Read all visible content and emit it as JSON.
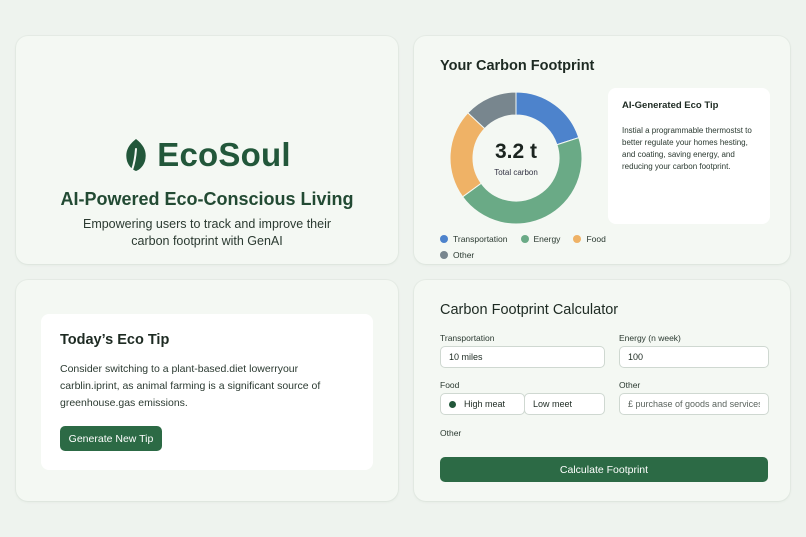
{
  "brand": {
    "name": "EcoSoul",
    "tagline": "AI-Powered Eco-Conscious Living",
    "description": "Empowering users to track and improve their carbon footprint with GenAI",
    "accent_color": "#22573a",
    "logo_icon": "leaf-icon"
  },
  "footprint": {
    "title": "Your Carbon Footprint",
    "total_value": "3.2 t",
    "total_label": "Total carbon",
    "ai_tip": {
      "title": "AI-Generated Eco Tip",
      "text": "Instial a programmable thermostst to better regulate your homes hesting, and coating, saving energy, and reducing your carbon footprint."
    }
  },
  "chart_data": {
    "type": "pie",
    "categories": [
      "Transportation",
      "Energy",
      "Food",
      "Other"
    ],
    "values": [
      20,
      45,
      22,
      13
    ],
    "colors": [
      "#4d83cc",
      "#6aaa86",
      "#efb266",
      "#78868e"
    ],
    "legend_position": "bottom-left",
    "center_text": "3.2 t",
    "center_subtext": "Total carbon"
  },
  "eco_tip": {
    "title": "Today’s Eco Tip",
    "text": "Consider switching to a plant-based.diet lowerryour carblin.iprint, as animal farming is a significant source of greenhouse.gas emissions.",
    "button_label": "Generate New Tip"
  },
  "calculator": {
    "title": "Carbon Footprint Calculator",
    "transportation_label": "Transportation",
    "transportation_value": "10 miles",
    "energy_label": "Energy (n week)",
    "energy_value": "100",
    "food_label": "Food",
    "food_options": [
      "High meat",
      "Low meet"
    ],
    "food_selected": "High meat",
    "other_label": "Other",
    "other_placeholder": "£ purchase of goods and services",
    "other_label_2": "Other",
    "button_label": "Calculate Footprint"
  },
  "colors": {
    "primary_button": "#2c6a45",
    "background": "#eef3ee",
    "card": "#f4f8f3"
  }
}
